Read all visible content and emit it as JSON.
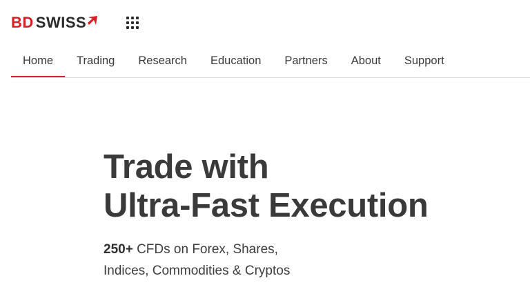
{
  "brand": {
    "logo_part1": "BD",
    "logo_part2": "SWISS",
    "accent_color": "#d81f26",
    "apps_icon": "grid-apps-icon"
  },
  "nav": {
    "items": [
      {
        "label": "Home",
        "active": true
      },
      {
        "label": "Trading",
        "active": false
      },
      {
        "label": "Research",
        "active": false
      },
      {
        "label": "Education",
        "active": false
      },
      {
        "label": "Partners",
        "active": false
      },
      {
        "label": "About",
        "active": false
      },
      {
        "label": "Support",
        "active": false
      }
    ]
  },
  "hero": {
    "title_line1": "Trade with",
    "title_line2": "Ultra-Fast Execution",
    "sub_highlight": "250+",
    "sub_line1_rest": " CFDs on Forex, Shares,",
    "sub_line2": "Indices, Commodities & Cryptos"
  }
}
